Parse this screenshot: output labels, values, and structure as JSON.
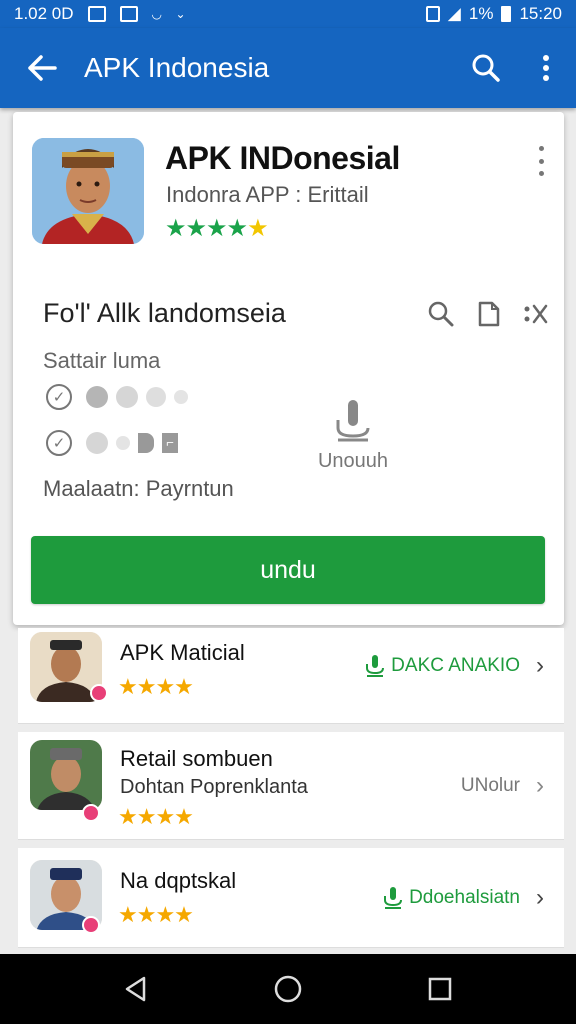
{
  "status_bar": {
    "time_left": "1.02 0D",
    "battery_pct": "1%",
    "clock": "15:20"
  },
  "app_bar": {
    "title": "APK Indonesia"
  },
  "app_card": {
    "name": "APK INDonesial",
    "subtitle": "Indonra APP : Erittail",
    "rating_green_stars": "★★★★",
    "rating_yellow_star": "★",
    "section_title": "Fo'l' Allk landomseia",
    "status_label": "Sattair luma",
    "mic_label": "Unouuh",
    "pay_label": "Maalaatn: Payrntun",
    "download_label": "undu"
  },
  "colors": {
    "app_bar": "#1565c0",
    "primary_button": "#1e9b3d",
    "rating_star": "#f5a800"
  },
  "list": [
    {
      "title": "APK Maticial",
      "subtitle": "",
      "stars": "★★★★",
      "action": "DAKC ANAKIO",
      "action_style": "green"
    },
    {
      "title": "Retail sombuen",
      "subtitle": "Dohtan Poprenklanta",
      "stars": "★★★★",
      "action": "UNolur",
      "action_style": "gray"
    },
    {
      "title": "Na dqptskal",
      "subtitle": "",
      "stars": "★★★★",
      "action": "Ddoehalsiatn",
      "action_style": "green"
    }
  ],
  "icons": {
    "back": "arrow-left-icon",
    "search": "search-icon",
    "more": "more-vert-icon",
    "mic": "microphone-icon",
    "chevron": "chevron-right-icon",
    "nav_back": "triangle-back-icon",
    "nav_home": "circle-home-icon",
    "nav_recent": "square-recent-icon"
  }
}
